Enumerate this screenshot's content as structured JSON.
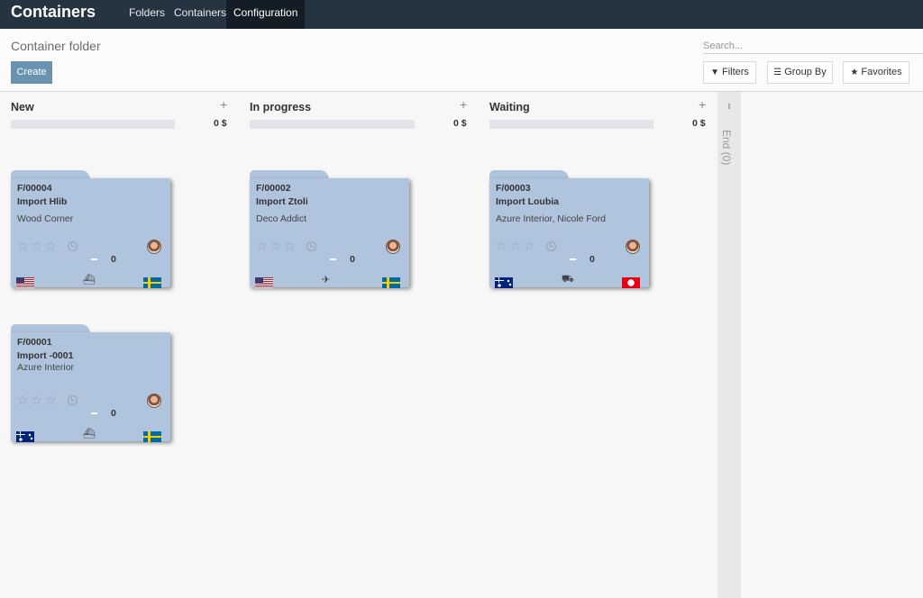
{
  "app": {
    "title": "Containers",
    "menu": [
      {
        "label": "Folders"
      },
      {
        "label": "Containers"
      },
      {
        "label": "Configuration",
        "active": true
      }
    ]
  },
  "control_panel": {
    "breadcrumb": "Container folder",
    "create_label": "Create",
    "search_placeholder": "Search...",
    "filters_label": "Filters",
    "groupby_label": "Group By",
    "favorites_label": "Favorites"
  },
  "columns": [
    {
      "title": "New",
      "sum": "0 $",
      "progress": 0
    },
    {
      "title": "In progress",
      "sum": "0 $",
      "progress": 0
    },
    {
      "title": "Waiting",
      "sum": "0 $",
      "progress": 0
    }
  ],
  "folded_column": {
    "label": "End (0)"
  },
  "cards": [
    {
      "ref": "F/00004",
      "name": "Import Hlib",
      "partner": "Wood Corner",
      "count": "0",
      "stars": 0,
      "origin_flag": "us",
      "dest_flag": "se",
      "transport": "ship-icon",
      "transport_glyph": "⛴"
    },
    {
      "ref": "F/00001",
      "name": "Import -0001",
      "partner": "Azure Interior",
      "count": "0",
      "stars": 0,
      "origin_flag": "au",
      "dest_flag": "se",
      "transport": "ship-icon",
      "transport_glyph": "⛴"
    },
    {
      "ref": "F/00002",
      "name": "Import Ztoli",
      "partner": "Deco Addict",
      "count": "0",
      "stars": 0,
      "origin_flag": "us",
      "dest_flag": "se",
      "transport": "plane-icon",
      "transport_glyph": "✈"
    },
    {
      "ref": "F/00003",
      "name": "Import Loubia",
      "partner": "Azure Interior, Nicole Ford",
      "count": "0",
      "stars": 0,
      "origin_flag": "au",
      "dest_flag": "tn",
      "transport": "truck-icon",
      "transport_glyph": "⛟"
    }
  ],
  "icons": {
    "star": "☆",
    "filter": "▼",
    "groupby": "☰",
    "favorites": "★",
    "add": "+"
  },
  "colors": {
    "navbar": "#263442",
    "card": "#b0c4de",
    "primary_button": "#6a93b1"
  }
}
